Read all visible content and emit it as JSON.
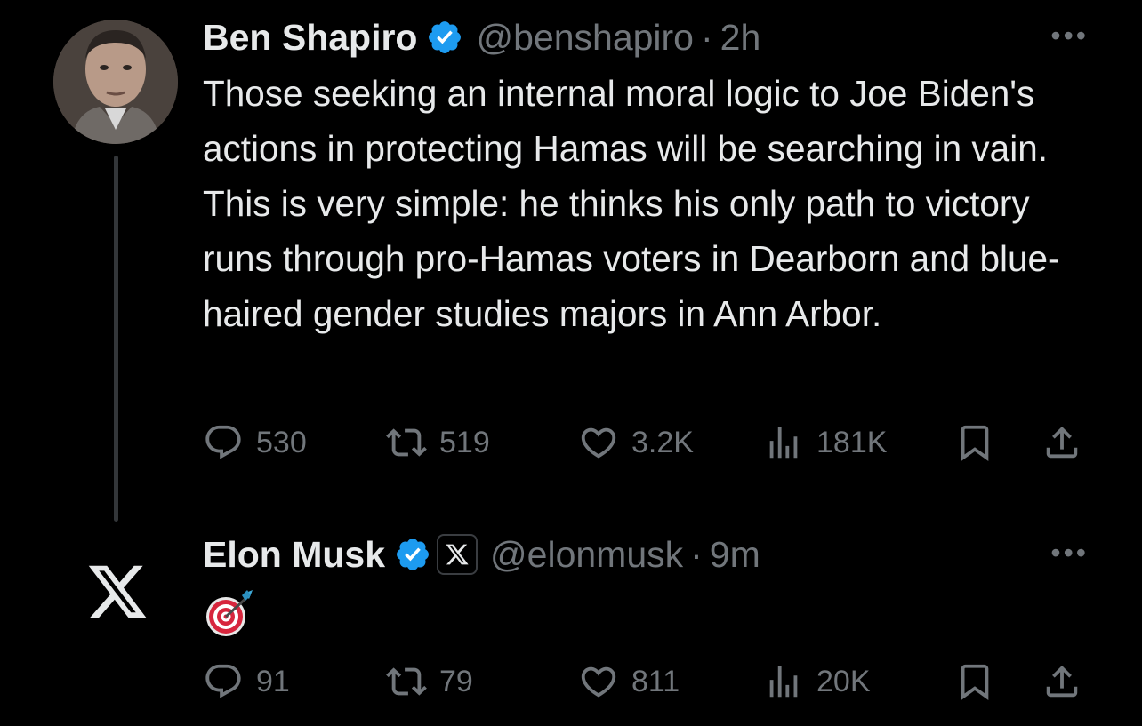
{
  "tweets": [
    {
      "author": "Ben Shapiro",
      "handle": "@benshapiro",
      "separator": "·",
      "time": "2h",
      "more": "•••",
      "text": "Those seeking an internal moral logic to Joe Biden's actions in protecting Hamas will be searching in vain. This is very simple: he thinks his only path to victory runs through pro-Hamas voters in Dearborn and blue-haired gender studies majors in Ann Arbor.",
      "stats": {
        "replies": "530",
        "retweets": "519",
        "likes": "3.2K",
        "views": "181K"
      }
    },
    {
      "author": "Elon Musk",
      "handle": "@elonmusk",
      "separator": "·",
      "time": "9m",
      "more": "•••",
      "text": "",
      "emoji_icon": "direct-hit-target-icon",
      "affiliation_badge_icon": "x-logo-icon",
      "stats": {
        "replies": "91",
        "retweets": "79",
        "likes": "811",
        "views": "20K"
      }
    }
  ],
  "colors": {
    "background": "#000000",
    "text_primary": "#e7e9ea",
    "text_secondary": "#71767b",
    "verified_blue": "#1d9bf0",
    "thread_line": "#333639"
  }
}
